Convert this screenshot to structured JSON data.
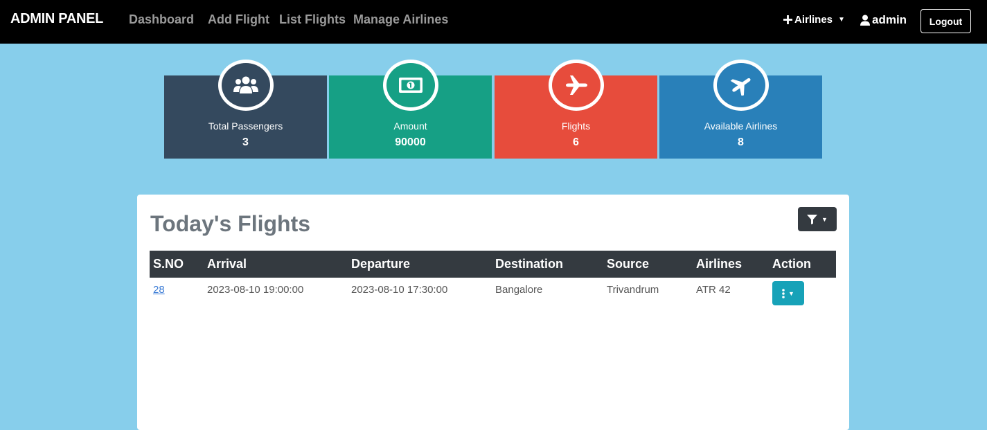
{
  "navbar": {
    "brand": "ADMIN PANEL",
    "links": [
      "Dashboard",
      "Add Flight",
      "List Flights",
      "Manage Airlines"
    ],
    "airlines_dropdown": "Airlines",
    "user": "admin",
    "logout_label": "Logout",
    "colors": {
      "background": "#000000",
      "link": "#9a9a9a"
    }
  },
  "stats": [
    {
      "label": "Total Passengers",
      "value": "3",
      "icon": "users-icon",
      "color": "#34495e"
    },
    {
      "label": "Amount",
      "value": "90000",
      "icon": "money-bill-icon",
      "color": "#16a085"
    },
    {
      "label": "Flights",
      "value": "6",
      "icon": "plane-icon",
      "color": "#e74c3c"
    },
    {
      "label": "Available Airlines",
      "value": "8",
      "icon": "plane-departure-icon",
      "color": "#2980b9"
    }
  ],
  "flights_panel": {
    "title": "Today's Flights",
    "filter_icon": "filter-icon",
    "columns": [
      "S.NO",
      "Arrival",
      "Departure",
      "Destination",
      "Source",
      "Airlines",
      "Action"
    ],
    "rows": [
      {
        "sno": "28",
        "arrival": "2023-08-10 19:00:00",
        "departure": "2023-08-10 17:30:00",
        "destination": "Bangalore",
        "source": "Trivandrum",
        "airline": "ATR 42",
        "action_icon": "ellipsis-vertical-icon"
      }
    ]
  },
  "colors": {
    "page_background": "#87ceeb",
    "table_header": "#343a40",
    "action_button": "#17a2b8"
  }
}
